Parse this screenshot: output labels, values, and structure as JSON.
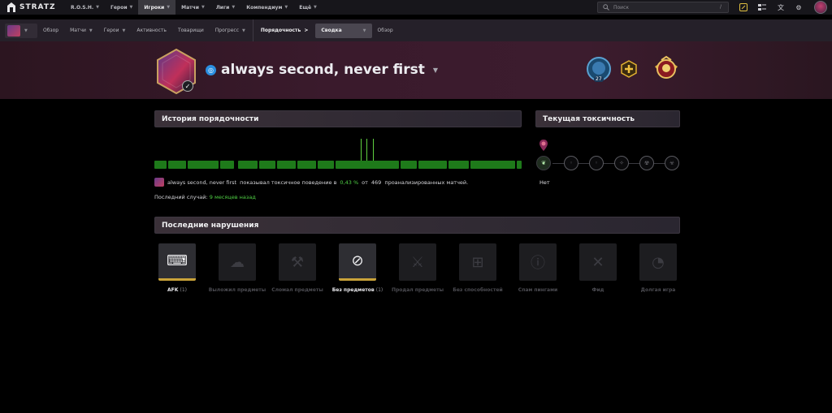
{
  "topbar": {
    "brand": "STRATZ",
    "nav": [
      {
        "label": "R.O.S.H."
      },
      {
        "label": "Герои"
      },
      {
        "label": "Игроки",
        "active": true
      },
      {
        "label": "Матчи"
      },
      {
        "label": "Лиги"
      },
      {
        "label": "Компендиум"
      },
      {
        "label": "Ещё"
      }
    ],
    "search_placeholder": "Поиск",
    "search_shortcut": "/"
  },
  "subnav": {
    "items": [
      "Обзор",
      "Матчи",
      "Герои",
      "Активность",
      "Товарищи",
      "Прогресс"
    ],
    "section": "Порядочность",
    "section_arrow": ">",
    "selected_view": "Сводка",
    "after": "Обзор"
  },
  "profile": {
    "name": "always second, never first",
    "rank_number": "27"
  },
  "behavior": {
    "history_title": "История порядочности",
    "toxicity_title": "Текущая токсичность",
    "stat_name": "always second, never first",
    "stat_text_1": "показывал токсичное поведение в",
    "stat_percent": "0,43 %",
    "stat_text_2": "от",
    "stat_total": "469",
    "stat_text_3": "проанализированных матчей.",
    "last_case_label": "Последний случай:",
    "last_case_value": "9 месяцев назад",
    "toxicity_level": "Нет"
  },
  "violations": {
    "title": "Последние нарушения",
    "items": [
      {
        "label": "AFK",
        "count": "(1)",
        "hit": true,
        "icon": "afk-icon"
      },
      {
        "label": "Выложил предметы",
        "count": "",
        "hit": false,
        "icon": "dropped-items-icon"
      },
      {
        "label": "Сломал предметы",
        "count": "",
        "hit": false,
        "icon": "broken-items-icon"
      },
      {
        "label": "Без предметов",
        "count": "(1)",
        "hit": true,
        "icon": "no-items-icon"
      },
      {
        "label": "Продал предметы",
        "count": "",
        "hit": false,
        "icon": "sold-items-icon"
      },
      {
        "label": "Без способностей",
        "count": "",
        "hit": false,
        "icon": "no-abilities-icon"
      },
      {
        "label": "Спам пингами",
        "count": "",
        "hit": false,
        "icon": "ping-spam-icon"
      },
      {
        "label": "Фид",
        "count": "",
        "hit": false,
        "icon": "feed-icon"
      },
      {
        "label": "Долгая игра",
        "count": "",
        "hit": false,
        "icon": "long-game-icon"
      }
    ]
  },
  "colors": {
    "accent_green": "#4fcf44",
    "bar_green": "#1e7a1a",
    "gold": "#c9a33a"
  }
}
